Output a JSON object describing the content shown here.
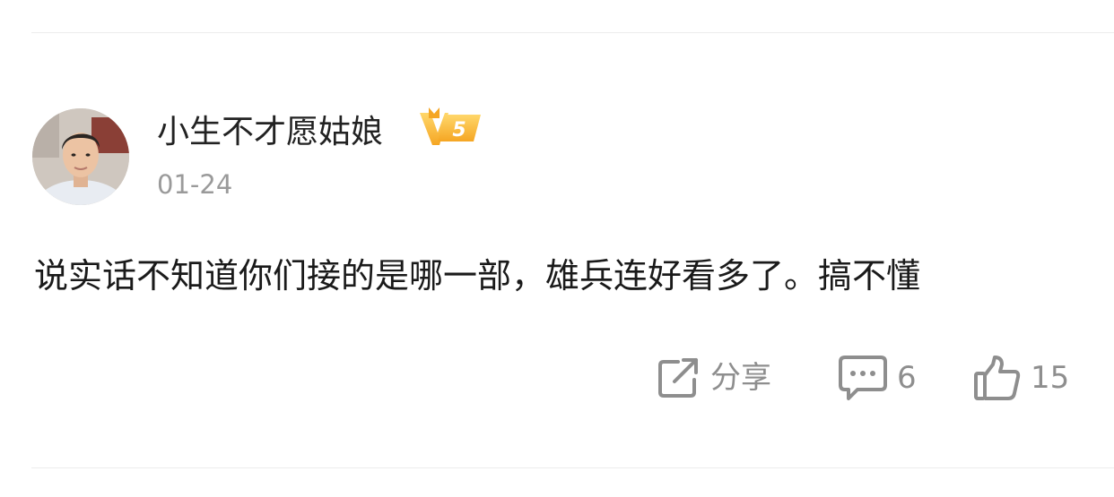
{
  "post": {
    "author": "小生不才愿姑娘",
    "level_badge": "5",
    "date": "01-24",
    "text": "说实话不知道你们接的是哪一部，雄兵连好看多了。搞不懂"
  },
  "actions": {
    "share_label": "分享",
    "comment_count": "6",
    "like_count": "15"
  },
  "colors": {
    "text_primary": "#1a1a1a",
    "text_secondary": "#9a9a9a",
    "icon_gray": "#8e8e8e",
    "badge_gold": "#f5a623",
    "divider": "#ececec"
  }
}
